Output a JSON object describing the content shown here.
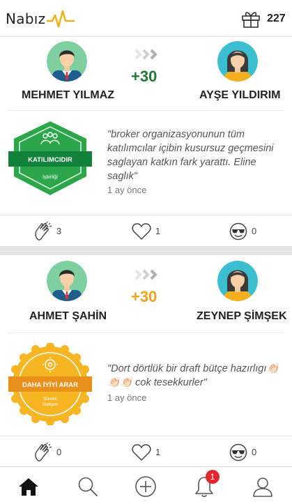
{
  "header": {
    "app_name": "Nabız",
    "points": "227"
  },
  "feed": [
    {
      "giver_name": "MEHMET YILMAZ",
      "receiver_name": "AYŞE YILDIRIM",
      "score": "+30",
      "score_color": "#1e7a34",
      "badge_title": "KATILIMCIDIR",
      "badge_subtitle": "İşbirliği",
      "badge_color": "#2ca64a",
      "quote": "\"broker organizasyonunun  tüm katılımcılar içibin kusursuz geçmesini saglayan katkın fark yarattı. Eline saglık\"",
      "time": "1 ay önce",
      "claps": "3",
      "likes": "1",
      "cools": "0"
    },
    {
      "giver_name": "AHMET ŞAHİN",
      "receiver_name": "ZEYNEP ŞİMŞEK",
      "score": "+30",
      "score_color": "#f2a31b",
      "badge_title": "DAHA İYİYİ ARAR",
      "badge_subtitle": "Sürekli Gelişim",
      "badge_color": "#f6b623",
      "quote": "\"Dort dörtlük bir draft bütçe hazırlıgı👏🏻👏🏻👏🏻 cok tesekkurler\"",
      "time": "1 ay önce",
      "claps": "0",
      "likes": "1",
      "cools": "0"
    }
  ],
  "tabbar": {
    "notification_count": "1",
    "tabs": [
      "home-icon",
      "search-icon",
      "add-icon",
      "bell-icon",
      "profile-icon"
    ]
  },
  "colors": {
    "pulse": "#f2b01e",
    "avatar_bg_male": "#7fd0a0",
    "avatar_bg_female": "#3bbfd0",
    "notification": "#e0262e"
  }
}
